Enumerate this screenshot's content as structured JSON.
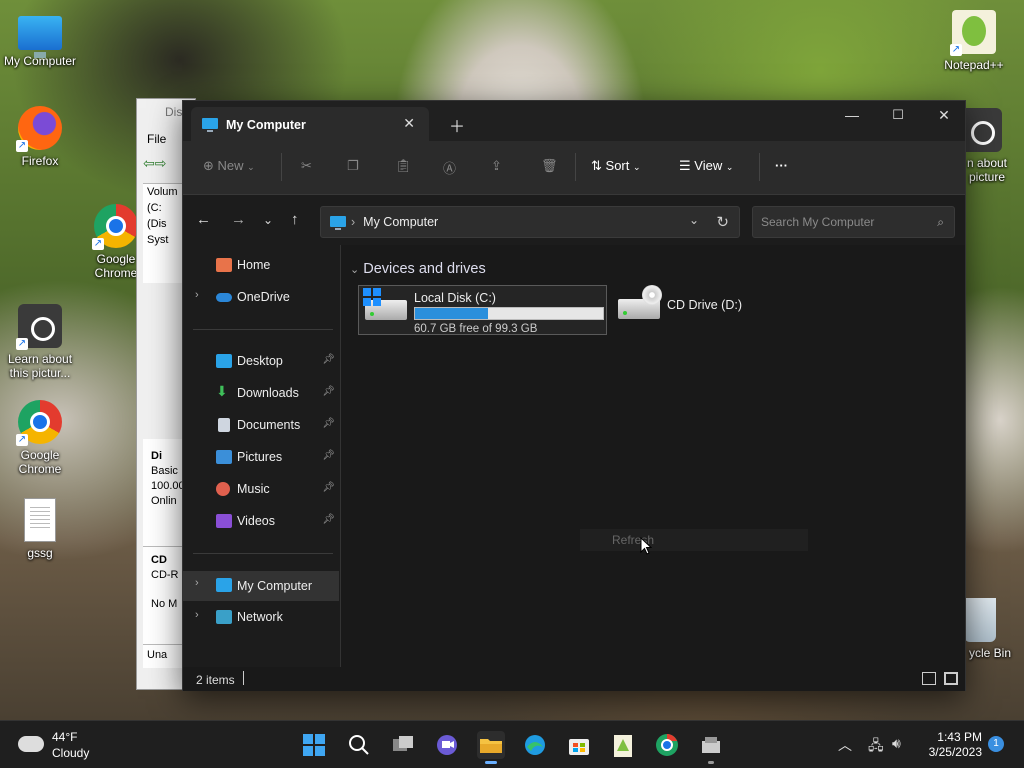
{
  "desktop": {
    "icons": [
      {
        "label": "My Computer",
        "icon": "computer-icon"
      },
      {
        "label": "Firefox",
        "icon": "firefox-icon"
      },
      {
        "label": "Google Chrome",
        "icon": "chrome-icon"
      },
      {
        "label": "Learn about this pictur...",
        "icon": "camera-icon"
      },
      {
        "label": "Google Chrome",
        "icon": "chrome-icon"
      },
      {
        "label": "gssg",
        "icon": "text-file-icon"
      },
      {
        "label": "Notepad++",
        "icon": "notepadpp-icon"
      },
      {
        "label": "n about picture",
        "icon": "camera-icon"
      },
      {
        "label": "ycle Bin",
        "icon": "recycle-bin-icon"
      }
    ]
  },
  "background_window": {
    "title": "Dis",
    "menu": "File",
    "volume_header": "Volum",
    "volume_rows": [
      "(C:",
      "(Dis",
      "Syst"
    ],
    "disk_label": "Di",
    "disk_lines": [
      "Basic",
      "100.00",
      "Onlin"
    ],
    "cd_label": "CD",
    "cd_lines": [
      "CD-R",
      "No M"
    ],
    "unalloc": "Una"
  },
  "explorer": {
    "tab_title": "My Computer",
    "toolbar": {
      "new_label": "New",
      "sort_label": "Sort",
      "view_label": "View",
      "more_label": "···"
    },
    "address": {
      "crumb": "My Computer"
    },
    "search": {
      "placeholder": "Search My Computer"
    },
    "sidebar": {
      "items": [
        {
          "label": "Home"
        },
        {
          "label": "OneDrive"
        },
        {
          "label": "Desktop"
        },
        {
          "label": "Downloads"
        },
        {
          "label": "Documents"
        },
        {
          "label": "Pictures"
        },
        {
          "label": "Music"
        },
        {
          "label": "Videos"
        },
        {
          "label": "My Computer"
        },
        {
          "label": "Network"
        }
      ]
    },
    "content": {
      "group_title": "Devices and drives",
      "drives": [
        {
          "name": "Local Disk (C:)",
          "free_text": "60.7 GB free of 99.3 GB",
          "used_fraction": 0.389
        },
        {
          "name": "CD Drive (D:)"
        }
      ],
      "tooltip": "Refresh"
    },
    "status": {
      "item_count": "2 items"
    }
  },
  "taskbar": {
    "weather_temp": "44°F",
    "weather_cond": "Cloudy",
    "time": "1:43 PM",
    "date": "3/25/2023",
    "notification_count": "1"
  },
  "colors": {
    "accent": "#2a8fdc",
    "explorer_bg": "#191919",
    "toolbar_bg": "#2b2b2b"
  }
}
